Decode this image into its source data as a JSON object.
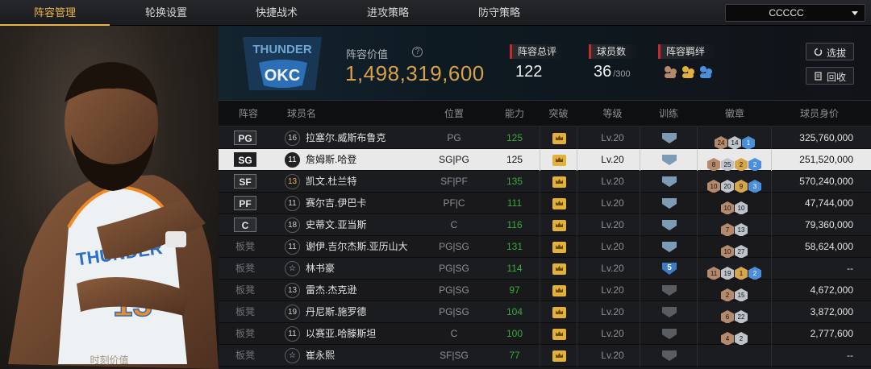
{
  "nav": {
    "tabs": [
      {
        "label": "阵容管理",
        "active": true
      },
      {
        "label": "轮换设置",
        "active": false
      },
      {
        "label": "快捷战术",
        "active": false
      },
      {
        "label": "进攻策略",
        "active": false
      },
      {
        "label": "防守策略",
        "active": false
      }
    ],
    "team_select": "CCCCC"
  },
  "header": {
    "value_label": "阵容价值",
    "value_amount": "1,498,319,600",
    "overall_label": "阵容总评",
    "overall_value": "122",
    "count_label": "球员数",
    "count_value": "36",
    "count_max": "/300",
    "chem_label": "阵容羁绊",
    "btn_select": "选拔",
    "btn_recycle": "回收",
    "logo_text": "OKC",
    "logo_top_text": "THUNDER"
  },
  "portrait": {
    "caption": "时刻价值"
  },
  "colors": {
    "accent": "#e8b44a",
    "value_gold": "#d9a04a",
    "ability_green": "#3aaa3a",
    "stat_red": "#c42b2b"
  },
  "table": {
    "columns": [
      "阵容",
      "球员名",
      "位置",
      "能力",
      "突破",
      "等级",
      "训练",
      "徽章",
      "球员身价"
    ],
    "rows": [
      {
        "slot": "PG",
        "starter": true,
        "jersey": "16",
        "name": "拉塞尔.威斯布鲁克",
        "pos": "PG",
        "ability": "125",
        "level": "Lv.20",
        "train": "shield",
        "train_num": "",
        "badges": [
          [
            "bronze",
            "24"
          ],
          [
            "silver",
            "14"
          ],
          [
            "blue",
            "1"
          ]
        ],
        "value": "325,760,000"
      },
      {
        "slot": "SG",
        "starter": true,
        "jersey": "11",
        "name": "詹姆斯.哈登",
        "pos": "SG|PG",
        "ability": "125",
        "level": "Lv.20",
        "train": "shield",
        "train_num": "",
        "badges": [
          [
            "bronze",
            "8"
          ],
          [
            "silver",
            "25"
          ],
          [
            "gold",
            "2"
          ],
          [
            "blue",
            "2"
          ]
        ],
        "value": "251,520,000"
      },
      {
        "slot": "SF",
        "starter": true,
        "jersey": "13",
        "name": "凯文.杜兰特",
        "pos": "SF|PF",
        "ability": "135",
        "level": "Lv.20",
        "train": "shield",
        "train_num": "",
        "badges": [
          [
            "bronze",
            "10"
          ],
          [
            "silver",
            "20"
          ],
          [
            "gold",
            "9"
          ],
          [
            "blue",
            "3"
          ]
        ],
        "value": "570,240,000"
      },
      {
        "slot": "PF",
        "starter": true,
        "jersey": "11",
        "name": "赛尔吉.伊巴卡",
        "pos": "PF|C",
        "ability": "111",
        "level": "Lv.20",
        "train": "shield",
        "train_num": "",
        "badges": [
          [
            "bronze",
            "10"
          ],
          [
            "silver",
            "10"
          ]
        ],
        "value": "47,744,000"
      },
      {
        "slot": "C",
        "starter": true,
        "jersey": "18",
        "name": "史蒂文.亚当斯",
        "pos": "C",
        "ability": "116",
        "level": "Lv.20",
        "train": "shield",
        "train_num": "",
        "badges": [
          [
            "bronze",
            "7"
          ],
          [
            "silver",
            "13"
          ]
        ],
        "value": "79,360,000"
      },
      {
        "slot": "板凳",
        "starter": false,
        "jersey": "11",
        "name": "谢伊.吉尔杰斯.亚历山大",
        "pos": "PG|SG",
        "ability": "131",
        "level": "Lv.20",
        "train": "shield",
        "train_num": "",
        "badges": [
          [
            "bronze",
            "10"
          ],
          [
            "silver",
            "27"
          ]
        ],
        "value": "58,624,000"
      },
      {
        "slot": "板凳",
        "starter": false,
        "jersey": "☆",
        "name": "林书豪",
        "pos": "PG|SG",
        "ability": "114",
        "level": "Lv.20",
        "train": "num",
        "train_num": "5",
        "badges": [
          [
            "bronze",
            "11"
          ],
          [
            "silver",
            "19"
          ],
          [
            "gold",
            "1"
          ],
          [
            "blue",
            "2"
          ]
        ],
        "value": "--"
      },
      {
        "slot": "板凳",
        "starter": false,
        "jersey": "13",
        "name": "雷杰.杰克逊",
        "pos": "PG|SG",
        "ability": "97",
        "level": "Lv.20",
        "train": "empty",
        "train_num": "",
        "badges": [
          [
            "bronze",
            "2"
          ],
          [
            "silver",
            "15"
          ]
        ],
        "value": "4,672,000"
      },
      {
        "slot": "板凳",
        "starter": false,
        "jersey": "19",
        "name": "丹尼斯.施罗德",
        "pos": "PG|SG",
        "ability": "104",
        "level": "Lv.20",
        "train": "empty",
        "train_num": "",
        "badges": [
          [
            "bronze",
            "6"
          ],
          [
            "silver",
            "22"
          ]
        ],
        "value": "3,872,000"
      },
      {
        "slot": "板凳",
        "starter": false,
        "jersey": "11",
        "name": "以赛亚.哈滕斯坦",
        "pos": "C",
        "ability": "100",
        "level": "Lv.20",
        "train": "empty",
        "train_num": "",
        "badges": [
          [
            "bronze",
            "4"
          ],
          [
            "silver",
            "2"
          ]
        ],
        "value": "2,777,600"
      },
      {
        "slot": "板凳",
        "starter": false,
        "jersey": "☆",
        "name": "崔永熙",
        "pos": "SF|SG",
        "ability": "77",
        "level": "Lv.20",
        "train": "empty",
        "train_num": "",
        "badges": [],
        "value": "--"
      }
    ]
  }
}
